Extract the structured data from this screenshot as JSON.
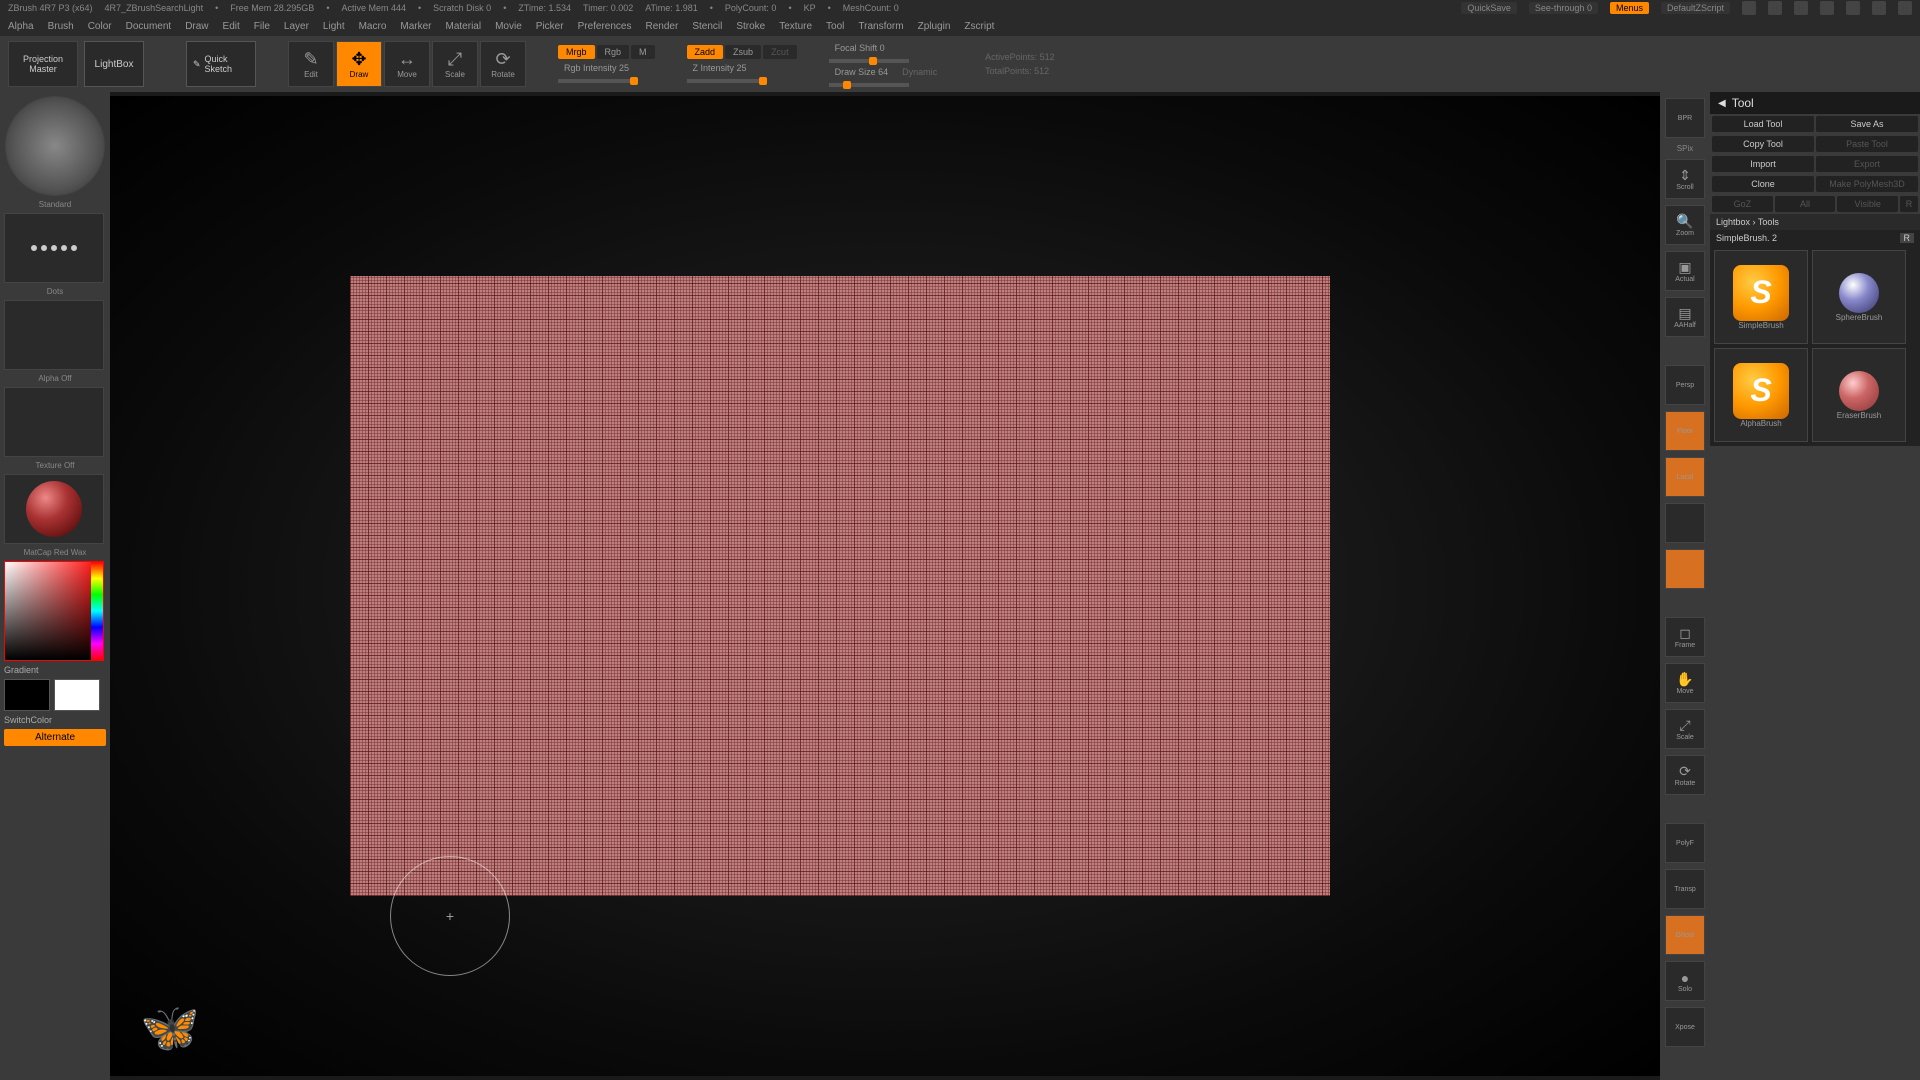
{
  "titlebar": {
    "app": "ZBrush 4R7 P3 (x64)",
    "doc": "4R7_ZBrushSearchLight",
    "free_mem": "Free Mem 28.295GB",
    "active_mem": "Active Mem 444",
    "scratch": "Scratch Disk 0",
    "ztime": "ZTime: 1.534",
    "timer": "Timer: 0.002",
    "atime": "ATime: 1.981",
    "polycount": "PolyCount: 0",
    "kp": "KP",
    "meshcount": "MeshCount: 0",
    "quicksave": "QuickSave",
    "seethrough": "See-through 0",
    "menus": "Menus",
    "defaultscript": "DefaultZScript"
  },
  "menubar": [
    "Alpha",
    "Brush",
    "Color",
    "Document",
    "Draw",
    "Edit",
    "File",
    "Layer",
    "Light",
    "Macro",
    "Marker",
    "Material",
    "Movie",
    "Picker",
    "Preferences",
    "Render",
    "Stencil",
    "Stroke",
    "Texture",
    "Tool",
    "Transform",
    "Zplugin",
    "Zscript"
  ],
  "toolbar": {
    "projection_master": "Projection Master",
    "lightbox": "LightBox",
    "quick_sketch": "Quick Sketch",
    "edit": "Edit",
    "draw": "Draw",
    "move": "Move",
    "scale": "Scale",
    "rotate": "Rotate",
    "mrgb": "Mrgb",
    "rgb": "Rgb",
    "m": "M",
    "rgb_intensity": "Rgb Intensity 25",
    "zadd": "Zadd",
    "zsub": "Zsub",
    "zcut": "Zcut",
    "z_intensity": "Z Intensity 25",
    "focal_shift": "Focal Shift 0",
    "draw_size": "Draw Size 64",
    "dynamic": "Dynamic",
    "active_points": "ActivePoints: 512",
    "total_points": "TotalPoints: 512"
  },
  "left": {
    "brush_name": "Standard",
    "stroke": "Dots",
    "alpha": "Alpha Off",
    "texture": "Texture Off",
    "material": "MatCap Red Wax",
    "gradient": "Gradient",
    "switch_color": "SwitchColor",
    "alternate": "Alternate"
  },
  "right_strip": {
    "bpr": "BPR",
    "spix": "SPix",
    "scroll": "Scroll",
    "zoom": "Zoom",
    "actual": "Actual",
    "aahalf": "AAHalf",
    "persp": "Persp",
    "floor": "Floor",
    "local": "Local",
    "frame": "Frame",
    "move": "Move",
    "scale": "Scale",
    "rotate": "Rotate",
    "polyf": "PolyF",
    "transp": "Transp",
    "ghost": "Ghost",
    "solo": "Solo",
    "xpose": "Xpose"
  },
  "tool_panel": {
    "title": "Tool",
    "load_tool": "Load Tool",
    "save_as": "Save As",
    "copy_tool": "Copy Tool",
    "paste_tool": "Paste Tool",
    "import": "Import",
    "export": "Export",
    "clone": "Clone",
    "make_polymesh": "Make PolyMesh3D",
    "goz": "GoZ",
    "all": "All",
    "visible": "Visible",
    "r_flag": "R",
    "lightbox_tools": "Lightbox › Tools",
    "current": "SimpleBrush. 2",
    "r": "R",
    "thumbs": [
      "SimpleBrush",
      "SphereBrush",
      "AlphaBrush",
      "EraserBrush"
    ]
  }
}
